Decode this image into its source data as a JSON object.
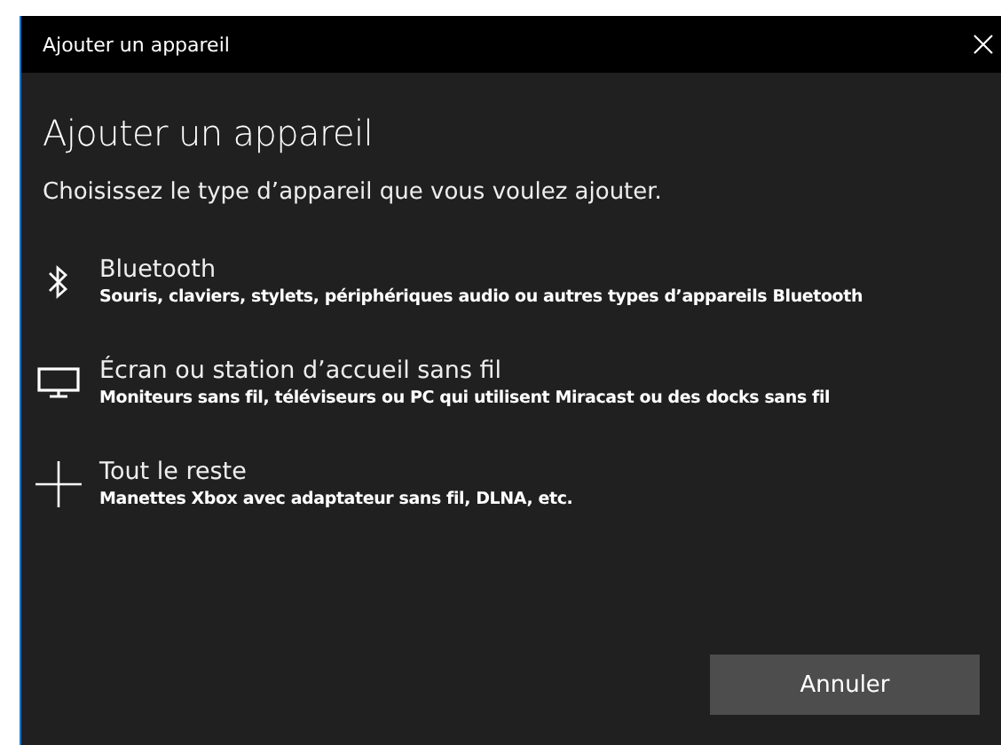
{
  "window": {
    "title": "Ajouter un appareil"
  },
  "heading": "Ajouter un appareil",
  "subtitle": "Choisissez le type d’appareil que vous voulez ajouter.",
  "options": [
    {
      "kind": "bluetooth",
      "title": "Bluetooth",
      "description": "Souris, claviers, stylets, périphériques audio ou autres types d’appareils Bluetooth"
    },
    {
      "kind": "display",
      "title": "Écran ou station d’accueil sans fil",
      "description": "Moniteurs sans fil, téléviseurs ou PC qui utilisent Miracast ou des docks sans fil"
    },
    {
      "kind": "other",
      "title": "Tout le reste",
      "description": "Manettes Xbox avec adaptateur sans fil, DLNA, etc."
    }
  ],
  "buttons": [
    "Annuler"
  ]
}
